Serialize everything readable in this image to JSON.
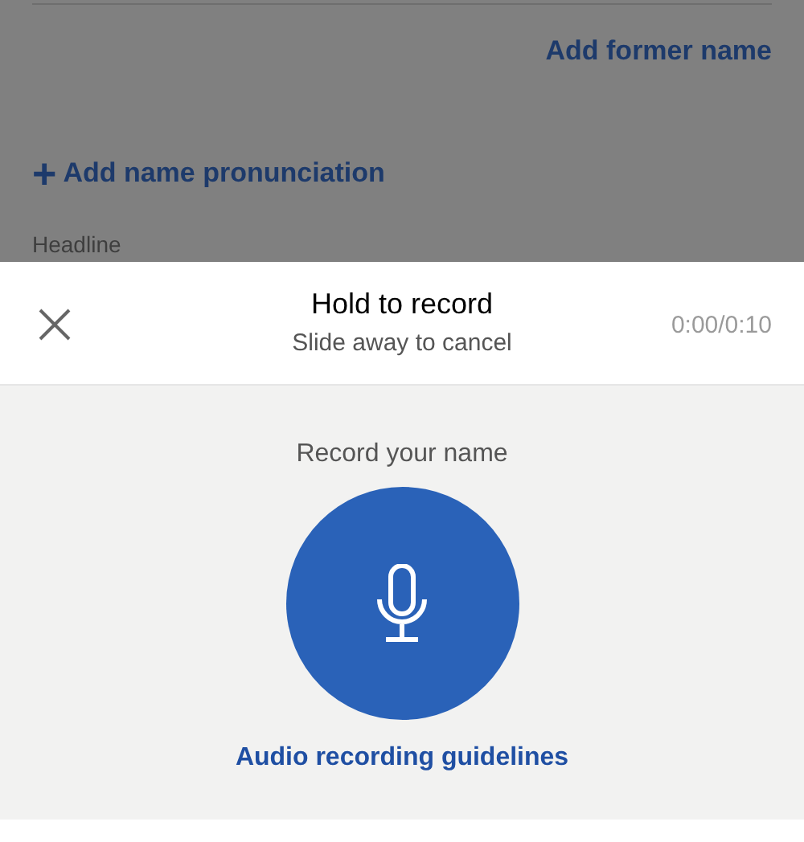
{
  "background_form": {
    "add_former_name": "Add former name",
    "add_pronunciation": {
      "icon": "+",
      "label": "Add name pronunciation"
    },
    "field_label": "Headline"
  },
  "record_sheet": {
    "title": "Hold to record",
    "subtitle": "Slide away to cancel",
    "timer": "0:00/0:10",
    "prompt": "Record your name",
    "guidelines_link": "Audio recording guidelines"
  }
}
